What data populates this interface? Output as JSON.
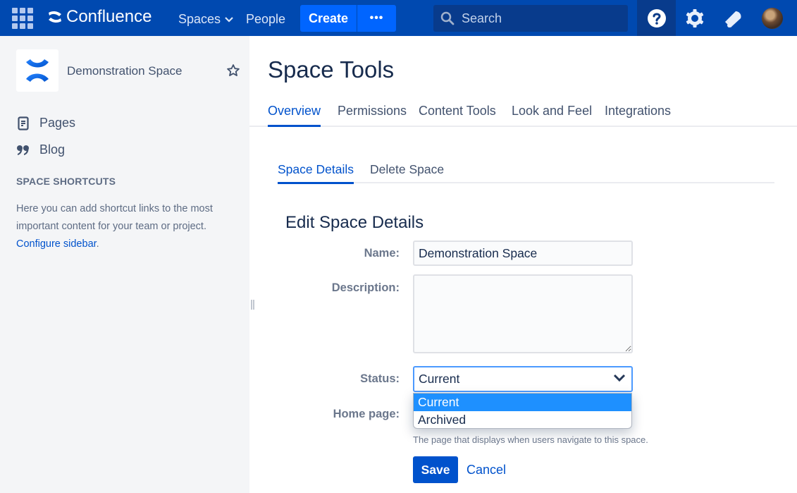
{
  "topnav": {
    "product_name": "Confluence",
    "spaces_label": "Spaces",
    "people_label": "People",
    "create_label": "Create",
    "more_label": "•••",
    "search_placeholder": "Search",
    "colors": {
      "bar": "#0049b0",
      "create": "#0065ff"
    }
  },
  "sidebar": {
    "space_name": "Demonstration Space",
    "items": [
      {
        "label": "Pages",
        "icon": "page-icon"
      },
      {
        "label": "Blog",
        "icon": "quote-icon"
      }
    ],
    "shortcuts_heading": "SPACE SHORTCUTS",
    "shortcuts_text": "Here you can add shortcut links to the most important content for your team or project. ",
    "configure_link": "Configure sidebar",
    "configure_suffix": "."
  },
  "main": {
    "title": "Space Tools",
    "tabs": [
      {
        "label": "Overview",
        "active": true
      },
      {
        "label": "Permissions",
        "active": false
      },
      {
        "label": "Content Tools",
        "active": false
      },
      {
        "label": "Look and Feel",
        "active": false
      },
      {
        "label": "Integrations",
        "active": false
      }
    ],
    "subtabs": [
      {
        "label": "Space Details",
        "active": true
      },
      {
        "label": "Delete Space",
        "active": false
      }
    ],
    "form": {
      "title": "Edit Space Details",
      "name_label": "Name:",
      "name_value": "Demonstration Space",
      "description_label": "Description:",
      "description_value": "",
      "status_label": "Status:",
      "status_value": "Current",
      "status_options": [
        "Current",
        "Archived"
      ],
      "homepage_label": "Home page:",
      "homepage_hint": "The page that displays when users navigate to this space.",
      "save_label": "Save",
      "cancel_label": "Cancel"
    }
  }
}
